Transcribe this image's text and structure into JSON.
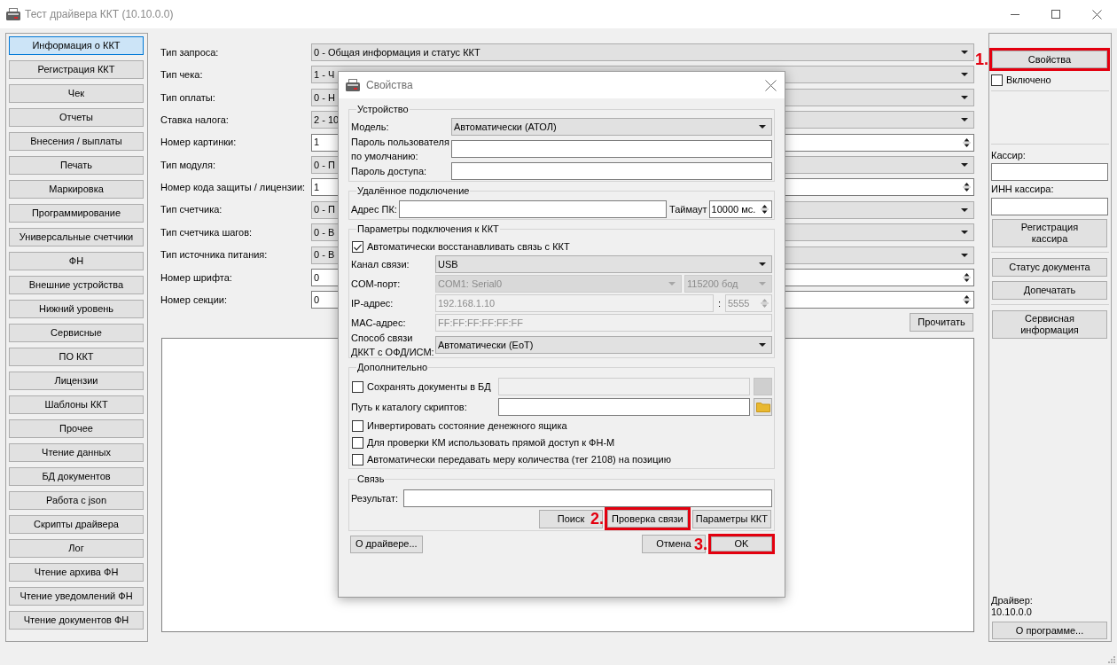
{
  "window": {
    "title": "Тест драйвера ККТ (10.10.0.0)"
  },
  "sidebar": {
    "items": [
      {
        "label": "Информация о ККТ",
        "selected": true
      },
      {
        "label": "Регистрация ККТ",
        "selected": false
      },
      {
        "label": "Чек",
        "selected": false
      },
      {
        "label": "Отчеты",
        "selected": false
      },
      {
        "label": "Внесения / выплаты",
        "selected": false
      },
      {
        "label": "Печать",
        "selected": false
      },
      {
        "label": "Маркировка",
        "selected": false
      },
      {
        "label": "Программирование",
        "selected": false
      },
      {
        "label": "Универсальные счетчики",
        "selected": false
      },
      {
        "label": "ФН",
        "selected": false
      },
      {
        "label": "Внешние устройства",
        "selected": false
      },
      {
        "label": "Нижний уровень",
        "selected": false
      },
      {
        "label": "Сервисные",
        "selected": false
      },
      {
        "label": "ПО ККТ",
        "selected": false
      },
      {
        "label": "Лицензии",
        "selected": false
      },
      {
        "label": "Шаблоны ККТ",
        "selected": false
      },
      {
        "label": "Прочее",
        "selected": false
      },
      {
        "label": "Чтение данных",
        "selected": false
      },
      {
        "label": "БД документов",
        "selected": false
      },
      {
        "label": "Работа с json",
        "selected": false
      },
      {
        "label": "Скрипты драйвера",
        "selected": false
      },
      {
        "label": "Лог",
        "selected": false
      },
      {
        "label": "Чтение архива ФН",
        "selected": false
      },
      {
        "label": "Чтение уведомлений ФН",
        "selected": false
      },
      {
        "label": "Чтение документов ФН",
        "selected": false
      }
    ]
  },
  "form": {
    "fields": [
      {
        "label": "Тип запроса:",
        "kind": "combo",
        "value": "0 - Общая информация и статус ККТ"
      },
      {
        "label": "Тип чека:",
        "kind": "combo",
        "value": "1 - Ч"
      },
      {
        "label": "Тип оплаты:",
        "kind": "combo",
        "value": "0 - Н"
      },
      {
        "label": "Ставка налога:",
        "kind": "combo",
        "value": "2 - 10"
      },
      {
        "label": "Номер картинки:",
        "kind": "spin",
        "value": "1"
      },
      {
        "label": "Тип модуля:",
        "kind": "combo",
        "value": "0 - П"
      },
      {
        "label": "Номер кода защиты / лицензии:",
        "kind": "spin",
        "value": "1"
      },
      {
        "label": "Тип счетчика:",
        "kind": "combo",
        "value": "0 - П"
      },
      {
        "label": "Тип счетчика шагов:",
        "kind": "combo",
        "value": "0 - В"
      },
      {
        "label": "Тип источника питания:",
        "kind": "combo",
        "value": "0 - В"
      },
      {
        "label": "Номер шрифта:",
        "kind": "spin",
        "value": "0"
      },
      {
        "label": "Номер секции:",
        "kind": "spin",
        "value": "0"
      }
    ],
    "read_button": "Прочитать"
  },
  "right_panel": {
    "properties": {
      "label": "Свойства",
      "step": "1.",
      "highlighted": true
    },
    "enabled": {
      "label": "Включено",
      "checked": false
    },
    "cashier": {
      "label": "Кассир:"
    },
    "cashier_inn": {
      "label": "ИНН кассира:"
    },
    "action_groups": [
      [
        "Регистрация\nкассира"
      ],
      [
        "Статус документа",
        "Допечатать"
      ],
      [
        "Сервисная\nинформация"
      ]
    ],
    "driver": {
      "label": "Драйвер:",
      "version": "10.10.0.0"
    },
    "about_button": "О программе..."
  },
  "dialog": {
    "title": "Свойства",
    "device": {
      "title": "Устройство",
      "model": {
        "label": "Модель:",
        "value": "Автоматически (АТОЛ)"
      },
      "user_password": {
        "label": "Пароль пользователя\nпо умолчанию:"
      },
      "access_password": {
        "label": "Пароль доступа:"
      }
    },
    "remote": {
      "title": "Удалённое подключение",
      "address": {
        "label": "Адрес ПК:"
      },
      "timeout": {
        "label": "Таймаут",
        "value": "10000 мс."
      }
    },
    "connection": {
      "title": "Параметры подключения к ККТ",
      "auto_reconnect": {
        "label": "Автоматически восстанавливать связь с ККТ",
        "checked": true
      },
      "channel": {
        "label": "Канал связи:",
        "value": "USB"
      },
      "com_port": {
        "label": "COM-порт:",
        "value": "COM1: Serial0",
        "baud": "115200 бод",
        "disabled": true
      },
      "ip": {
        "label": "IP-адрес:",
        "value": "192.168.1.10",
        "port_separator": ":",
        "port": "5555",
        "disabled": true
      },
      "mac": {
        "label": "MAC-адрес:",
        "value": "FF:FF:FF:FF:FF:FF",
        "disabled": true
      },
      "ofd_mode": {
        "label": "Способ связи\nДККТ с ОФД/ИСМ:",
        "value": "Автоматически (EoT)"
      }
    },
    "extra": {
      "title": "Дополнительно",
      "save_docs": {
        "label": "Сохранять документы в БД",
        "checked": false
      },
      "db_path": {
        "disabled": true
      },
      "scripts_path": {
        "label": "Путь к каталогу скриптов:"
      },
      "options": [
        {
          "label": "Инвертировать состояние денежного ящика",
          "checked": false
        },
        {
          "label": "Для проверки КМ использовать прямой доступ к ФН-М",
          "checked": false
        },
        {
          "label": "Автоматически передавать меру количества (тег 2108) на позицию",
          "checked": false
        }
      ]
    },
    "link": {
      "title": "Связь",
      "result": {
        "label": "Результат:"
      },
      "buttons": [
        {
          "label": "Поиск",
          "highlighted": false
        },
        {
          "label": "Проверка связи",
          "step": "2.",
          "highlighted": true
        },
        {
          "label": "Параметры ККТ",
          "highlighted": false
        }
      ]
    },
    "footer": {
      "about": "О драйвере...",
      "buttons": [
        {
          "label": "Отмена",
          "highlighted": false
        },
        {
          "label": "OK",
          "step": "3.",
          "highlighted": true
        }
      ]
    }
  }
}
